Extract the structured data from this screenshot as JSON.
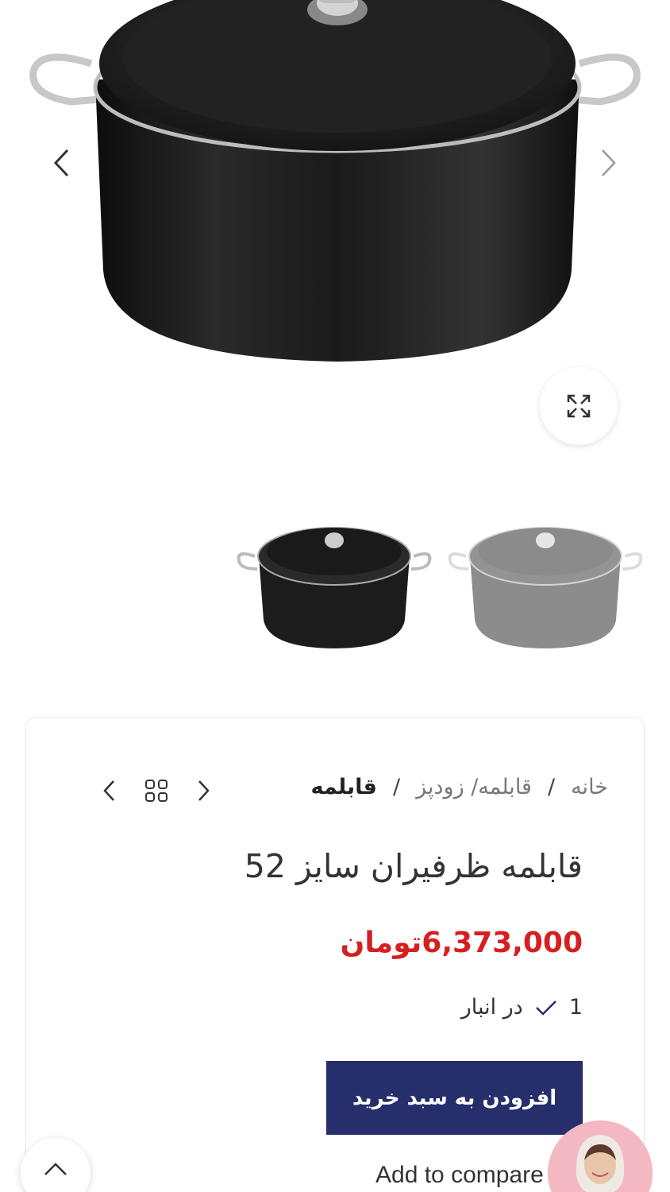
{
  "gallery": {
    "prev_icon": "chevron-left-icon",
    "next_icon": "chevron-right-icon",
    "zoom_icon": "expand-icon"
  },
  "thumbnails": [
    {
      "label": "black-pot-thumbnail",
      "active": true
    },
    {
      "label": "grey-pot-thumbnail",
      "active": false
    }
  ],
  "breadcrumb": {
    "home": "خانه",
    "separator": "/",
    "category": "قابلمه/ زودپز",
    "current": "قابلمه"
  },
  "product_nav": {
    "prev_icon": "chevron-left-icon",
    "grid_icon": "grid-icon",
    "next_icon": "chevron-right-icon"
  },
  "product": {
    "title": "قابلمه ظرفیران سایز 52",
    "price": "6,373,000تومان",
    "stock_count": "1",
    "stock_label": "در انبار",
    "add_to_cart_label": "افزودن به سبد خرید",
    "compare_label": "Add to compare"
  },
  "colors": {
    "price": "#d61f1f",
    "button": "#262e6b"
  }
}
